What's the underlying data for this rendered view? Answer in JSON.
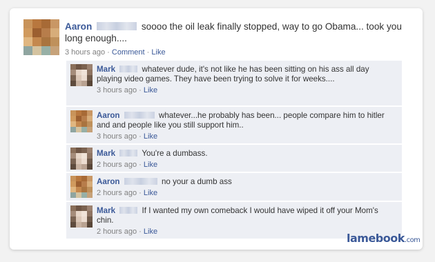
{
  "post": {
    "author": "Aaron",
    "text": "soooo the oil leak finally stopped, way to go Obama... took you long enough....",
    "time": "3 hours ago",
    "comment_link": "Comment",
    "like_link": "Like"
  },
  "comments": [
    {
      "author": "Mark",
      "text": "whatever dude, it's not like he has been sitting on his ass all day playing video games. They have been trying to solve it for weeks....",
      "time": "3 hours ago",
      "like": "Like"
    },
    {
      "author": "Aaron",
      "text": "whatever...he probably has been... people compare him to hitler and and people like you still support him..",
      "time": "3 hours ago",
      "like": "Like"
    },
    {
      "author": "Mark",
      "text": "You're a dumbass.",
      "time": "2 hours ago",
      "like": "Like"
    },
    {
      "author": "Aaron",
      "text": "no your a dumb ass",
      "time": "2 hours ago",
      "like": "Like"
    },
    {
      "author": "Mark",
      "text": "If I wanted my own comeback I would have wiped it off your Mom's chin.",
      "time": "2 hours ago",
      "like": "Like"
    }
  ],
  "watermark": {
    "brand": "lamebook",
    "suffix": ".com"
  },
  "colors": {
    "link": "#3b5998",
    "comment_bg": "#edeff4",
    "meta": "#808080"
  }
}
